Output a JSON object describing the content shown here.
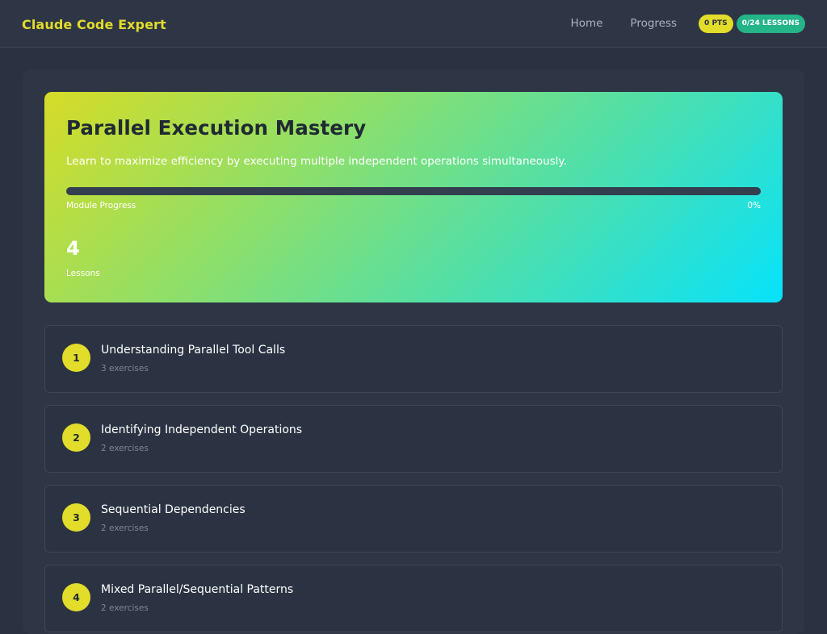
{
  "header": {
    "brand": "Claude Code Expert",
    "nav": {
      "home": "Home",
      "progress": "Progress"
    },
    "points_badge": "0 PTS",
    "lessons_badge": "0/24 LESSONS"
  },
  "module": {
    "title": "Parallel Execution Mastery",
    "description": "Learn to maximize efficiency by executing multiple independent operations simultaneously.",
    "progress_label": "Module Progress",
    "progress_percent_text": "0%",
    "progress_value": 0,
    "lesson_count": "4",
    "lesson_count_label": "Lessons"
  },
  "lessons": [
    {
      "number": "1",
      "title": "Understanding Parallel Tool Calls",
      "exercises": "3 exercises"
    },
    {
      "number": "2",
      "title": "Identifying Independent Operations",
      "exercises": "2 exercises"
    },
    {
      "number": "3",
      "title": "Sequential Dependencies",
      "exercises": "2 exercises"
    },
    {
      "number": "4",
      "title": "Mixed Parallel/Sequential Patterns",
      "exercises": "2 exercises"
    }
  ],
  "colors": {
    "accent_yellow": "#e2dc2a",
    "accent_green": "#23b488",
    "background": "#2a3140",
    "progress_track": "#333e4e"
  }
}
